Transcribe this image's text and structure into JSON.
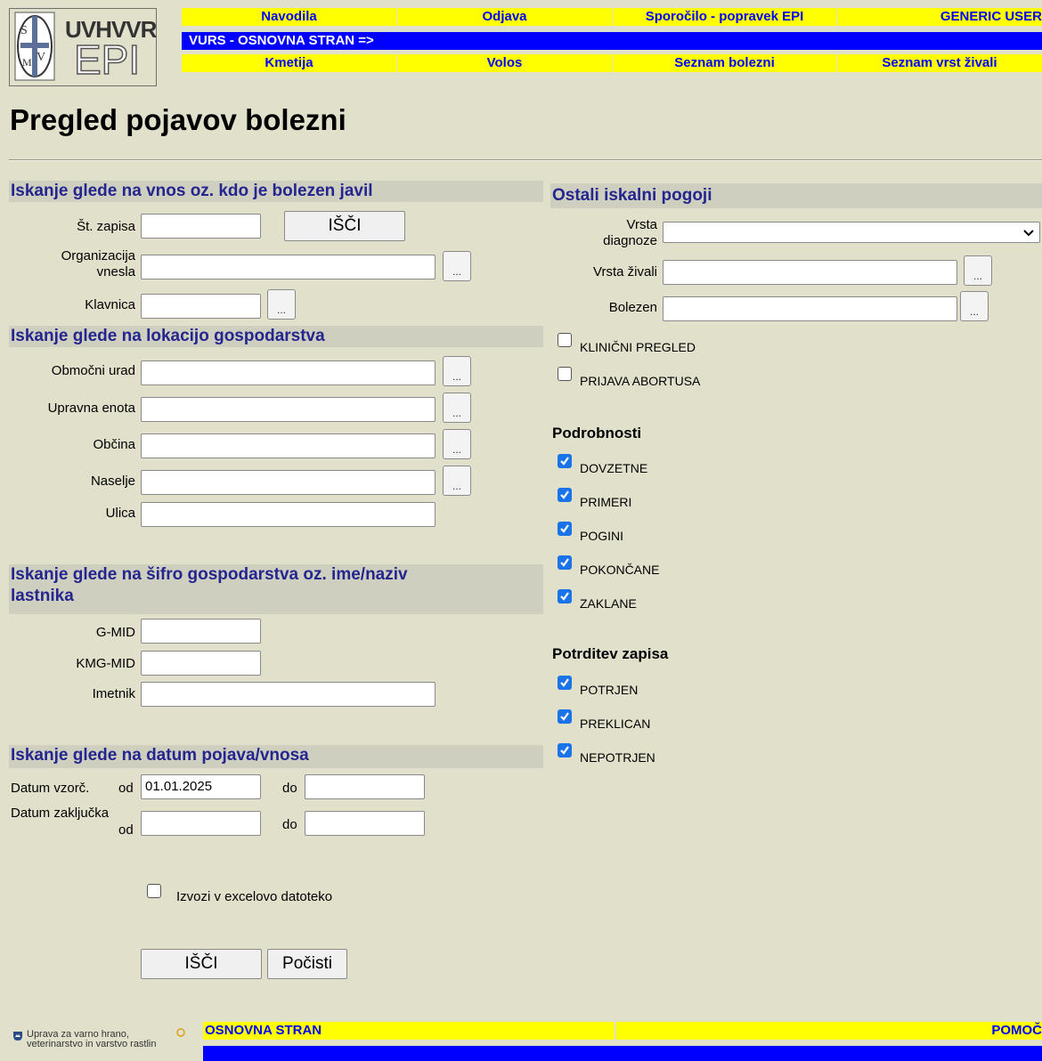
{
  "header": {
    "logo_top": "UVHVVR",
    "logo_bottom": "EPI",
    "nav_row1": [
      "Navodila",
      "Odjava",
      "Sporočilo - popravek EPI",
      "GENERIC USER"
    ],
    "main_link": "VURS - OSNOVNA STRAN =>",
    "nav_row2": [
      "Kmetija",
      "Volos",
      "Seznam bolezni",
      "Seznam vrst živali"
    ]
  },
  "page_title": "Pregled pojavov bolezni",
  "left": {
    "sec1": {
      "title": "Iskanje glede na vnos oz. kdo je bolezen javil",
      "st_zapisa_label": "Št. zapisa",
      "st_zapisa_value": "",
      "search_label": "IŠČI",
      "org_label_1": "Organizacija",
      "org_label_2": "vnesla",
      "klavnica_label": "Klavnica",
      "dots": "..."
    },
    "sec2": {
      "title": "Iskanje glede na lokacijo gospodarstva",
      "fields": [
        "Območni urad",
        "Upravna enota",
        "Občina",
        "Naselje",
        "Ulica"
      ]
    },
    "sec3": {
      "title_1": "Iskanje glede na šifro gospodarstva oz. ime/naziv",
      "title_2": "lastnika",
      "fields": [
        "G-MID",
        "KMG-MID",
        "Imetnik"
      ]
    },
    "sec4": {
      "title": "Iskanje glede na datum pojava/vnosa",
      "datum_vzorc_label": "Datum vzorč.",
      "od_label": "od",
      "od_value": "01.01.2025",
      "do_label": "do",
      "datum_zakl_label_1": "Datum zaključka",
      "datum_zakl_label_2": "od"
    },
    "export_label": "Izvozi v excelovo datoteko",
    "search_btn": "IŠČI",
    "clear_btn": "Počisti"
  },
  "right": {
    "title": "Ostali iskalni pogoji",
    "vrsta_diag_1": "Vrsta",
    "vrsta_diag_2": "diagnoze",
    "vrsta_zivali": "Vrsta živali",
    "bolezen": "Bolezen",
    "checks_top": [
      {
        "label": "KLINIČNI PREGLED",
        "checked": false
      },
      {
        "label": "PRIJAVA ABORTUSA",
        "checked": false
      }
    ],
    "podrobnosti_title": "Podrobnosti",
    "podrobnosti": [
      {
        "label": "DOVZETNE",
        "checked": true
      },
      {
        "label": "PRIMERI",
        "checked": true
      },
      {
        "label": "POGINI",
        "checked": true
      },
      {
        "label": "POKONČANE",
        "checked": true
      },
      {
        "label": "ZAKLANE",
        "checked": true
      }
    ],
    "potrditev_title": "Potrditev zapisa",
    "potrditev": [
      {
        "label": "POTRJEN",
        "checked": true
      },
      {
        "label": "PREKLICAN",
        "checked": true
      },
      {
        "label": "NEPOTRJEN",
        "checked": true
      }
    ]
  },
  "footer": {
    "org_1": "Uprava za varno hrano,",
    "org_2": "veterinarstvo in varstvo rastlin",
    "home": "OSNOVNA STRAN",
    "help": "POMOČ"
  },
  "colors": {
    "accent_yellow": "#ffff00",
    "accent_blue": "#0000ff",
    "section_text": "#25258f",
    "background": "#e1e0cb"
  }
}
